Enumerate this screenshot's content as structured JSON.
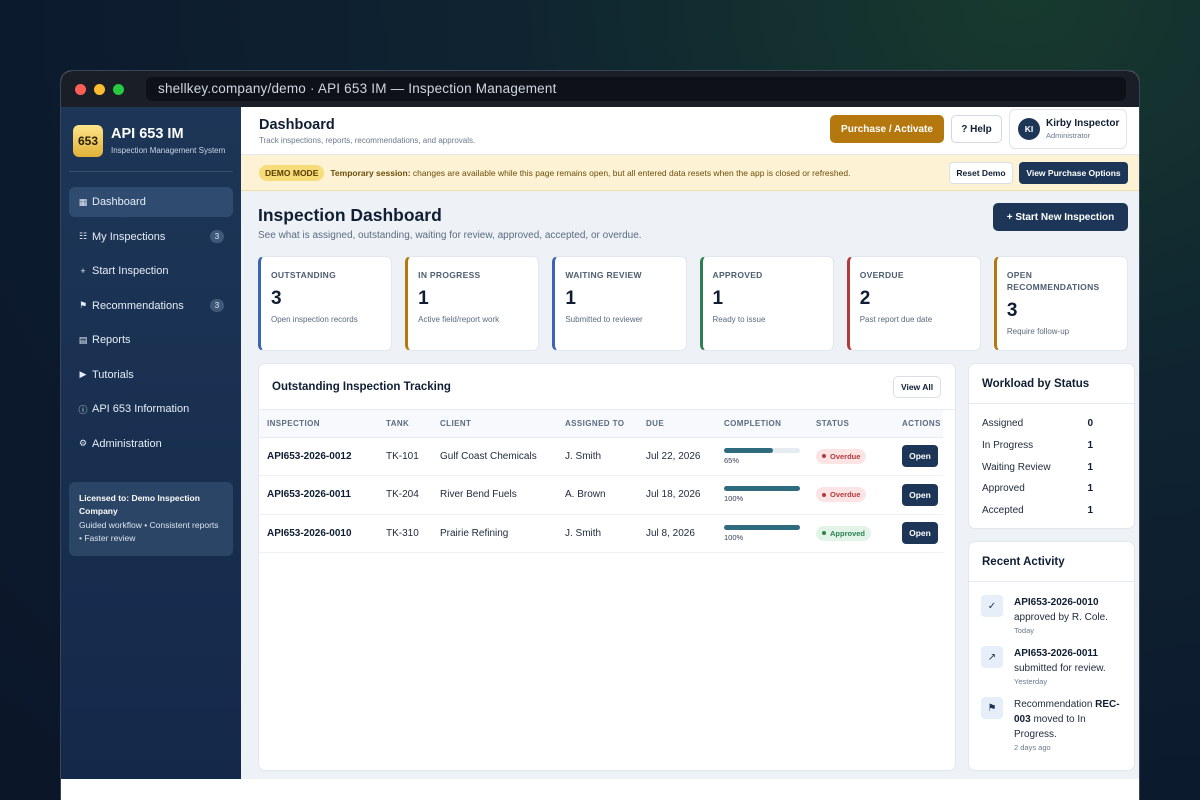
{
  "browser": {
    "url": "shellkey.company/demo · API 653 IM — Inspection Management"
  },
  "brand": {
    "logo_text": "653",
    "title": "API 653 IM",
    "subtitle": "Inspection Management System"
  },
  "nav": [
    {
      "icon": "▦",
      "label": "Dashboard",
      "badge": null
    },
    {
      "icon": "☷",
      "label": "My Inspections",
      "badge": "3"
    },
    {
      "icon": "+",
      "label": "Start Inspection",
      "badge": null
    },
    {
      "icon": "⚑",
      "label": "Recommendations",
      "badge": "3"
    },
    {
      "icon": "▤",
      "label": "Reports",
      "badge": null
    },
    {
      "icon": "▶",
      "label": "Tutorials",
      "badge": null
    },
    {
      "icon": "ⓘ",
      "label": "API 653 Information",
      "badge": null
    },
    {
      "icon": "⚙",
      "label": "Administration",
      "badge": null
    }
  ],
  "license": {
    "prefix": "Licensed to:",
    "company": "Demo Inspection Company",
    "tagline": "Guided workflow • Consistent reports • Faster review"
  },
  "topbar": {
    "title": "Dashboard",
    "subtitle": "Track inspections, reports, recommendations, and approvals.",
    "purchase_label": "Purchase / Activate",
    "help_label": "? Help"
  },
  "user": {
    "initials": "KI",
    "name": "Kirby Inspector",
    "role": "Administrator"
  },
  "demo": {
    "badge": "DEMO MODE",
    "bold": "Temporary session:",
    "text": "changes are available while this page remains open, but all entered data resets when the app is closed or refreshed.",
    "reset_label": "Reset Demo",
    "purchase_options_label": "View Purchase Options"
  },
  "dashboard": {
    "title": "Inspection Dashboard",
    "subtitle": "See what is assigned, outstanding, waiting for review, approved, accepted, or overdue.",
    "start_label": "+ Start New Inspection"
  },
  "cards": [
    {
      "label": "OUTSTANDING",
      "value": "3",
      "desc": "Open inspection records",
      "color": "#3b63b8"
    },
    {
      "label": "IN PROGRESS",
      "value": "1",
      "desc": "Active field/report work",
      "color": "#b5780f"
    },
    {
      "label": "WAITING REVIEW",
      "value": "1",
      "desc": "Submitted to reviewer",
      "color": "#3b63b8"
    },
    {
      "label": "APPROVED",
      "value": "1",
      "desc": "Ready to issue",
      "color": "#2e8050"
    },
    {
      "label": "OVERDUE",
      "value": "2",
      "desc": "Past report due date",
      "color": "#b23a3a"
    },
    {
      "label": "OPEN RECOMMENDATIONS",
      "value": "3",
      "desc": "Require follow-up",
      "color": "#b5780f"
    }
  ],
  "tracking": {
    "title": "Outstanding Inspection Tracking",
    "view_all_label": "View All",
    "columns": [
      "INSPECTION",
      "TANK",
      "CLIENT",
      "ASSIGNED TO",
      "DUE",
      "COMPLETION",
      "STATUS",
      "ACTIONS"
    ],
    "rows": [
      {
        "inspection": "API653-2026-0012",
        "tank": "TK-101",
        "client": "Gulf Coast Chemicals",
        "assigned": "J. Smith",
        "due": "Jul 22, 2026",
        "completion": 65,
        "completion_text": "65%",
        "status": "Overdue",
        "action": "Open"
      },
      {
        "inspection": "API653-2026-0011",
        "tank": "TK-204",
        "client": "River Bend Fuels",
        "assigned": "A. Brown",
        "due": "Jul 18, 2026",
        "completion": 100,
        "completion_text": "100%",
        "status": "Overdue",
        "action": "Open"
      },
      {
        "inspection": "API653-2026-0010",
        "tank": "TK-310",
        "client": "Prairie Refining",
        "assigned": "J. Smith",
        "due": "Jul 8, 2026",
        "completion": 100,
        "completion_text": "100%",
        "status": "Approved",
        "action": "Open"
      }
    ]
  },
  "status_colors": {
    "Overdue": {
      "bg": "#fde4e4",
      "fg": "#b23a3a"
    },
    "Approved": {
      "bg": "#e1f4e7",
      "fg": "#2e8050"
    }
  },
  "workload": {
    "title": "Workload by Status",
    "rows": [
      {
        "label": "Assigned",
        "value": "0"
      },
      {
        "label": "In Progress",
        "value": "1"
      },
      {
        "label": "Waiting Review",
        "value": "1"
      },
      {
        "label": "Approved",
        "value": "1"
      },
      {
        "label": "Accepted",
        "value": "1"
      }
    ]
  },
  "activity": {
    "title": "Recent Activity",
    "items": [
      {
        "icon": "✓",
        "bold": "API653-2026-0010",
        "text": "approved by R. Cole.",
        "time": "Today"
      },
      {
        "icon": "↗",
        "bold": "API653-2026-0011",
        "text": "submitted for review.",
        "time": "Yesterday"
      },
      {
        "icon": "⚑",
        "pre": "Recommendation",
        "bold": "REC-003",
        "text": "moved to In Progress.",
        "time": "2 days ago"
      }
    ]
  }
}
